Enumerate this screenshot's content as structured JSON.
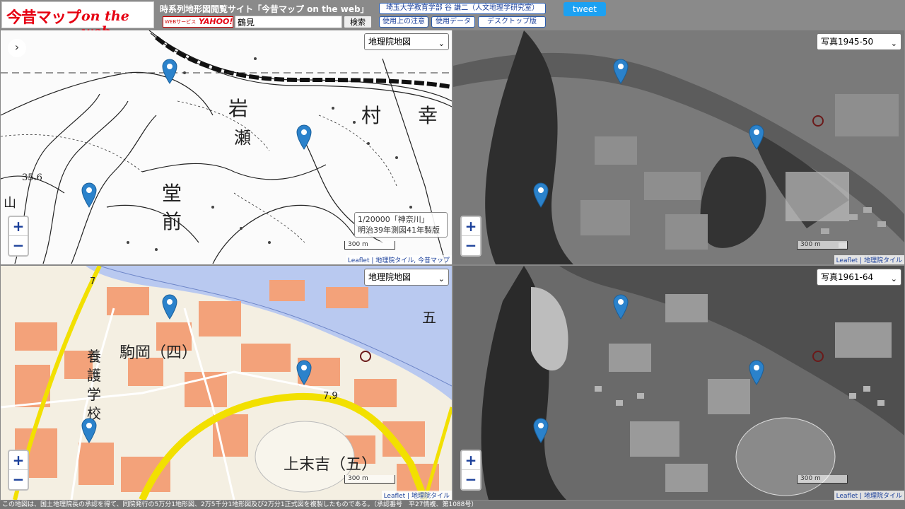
{
  "header": {
    "logo_jp": "今昔マップ",
    "logo_en": "on the web",
    "site_title": "時系列地形図閲覧サイト「今昔マップ on the web」",
    "yahoo_small": "WEBサービス",
    "yahoo_brand": "YAHOO!",
    "search_value": "鶴見",
    "search_button": "検索",
    "author_link": "埼玉大学教育学部 谷 謙二（人文地理学研究室）",
    "notes_link": "使用上の注意",
    "data_link": "使用データ",
    "desktop_link": "デスクトップ版",
    "tweet": "tweet"
  },
  "panes": {
    "top_left": {
      "layer": "地理院地図",
      "scale": "300 m",
      "attribution_leaflet": "Leaflet",
      "attribution_rest": "地理院タイル, 今昔マップ",
      "note_line1": "1/20000「神奈川」",
      "note_line2": "明治39年測図41年製版"
    },
    "top_right": {
      "layer": "写真1945-50",
      "scale": "300 m",
      "attribution_leaflet": "Leaflet",
      "attribution_rest": "地理院タイル"
    },
    "bottom_left": {
      "layer": "地理院地図",
      "scale": "300 m",
      "attribution_leaflet": "Leaflet",
      "attribution_rest": "地理院タイル"
    },
    "bottom_right": {
      "layer": "写真1961-64",
      "scale": "300 m",
      "attribution_leaflet": "Leaflet",
      "attribution_rest": "地理院タイル"
    }
  },
  "zoom": {
    "in": "+",
    "out": "−"
  },
  "map_labels": {
    "tl_iwase": "岩瀬",
    "tl_iwa": "岩",
    "tl_se": "瀬",
    "tl_mura": "村",
    "tl_sachi": "幸",
    "tl_do": "堂",
    "tl_mae": "前",
    "tl_yama": "山",
    "tl_elev": "35.6",
    "bl_komaoka": "駒岡（四）",
    "bl_kamisueyoshi": "上末吉（五）",
    "bl_school_1": "養",
    "bl_school_2": "護",
    "bl_school_3": "学",
    "bl_school_4": "校",
    "bl_five": "五",
    "bl_elev": "7.9",
    "bl_num": "7"
  },
  "footer": "この地図は、国土地理院長の承認を得て、同院発行の5万分1地形図、2万5千分1地形図及び2万分1正式図を複製したものである。（承認番号　平27情複、第1088号）"
}
